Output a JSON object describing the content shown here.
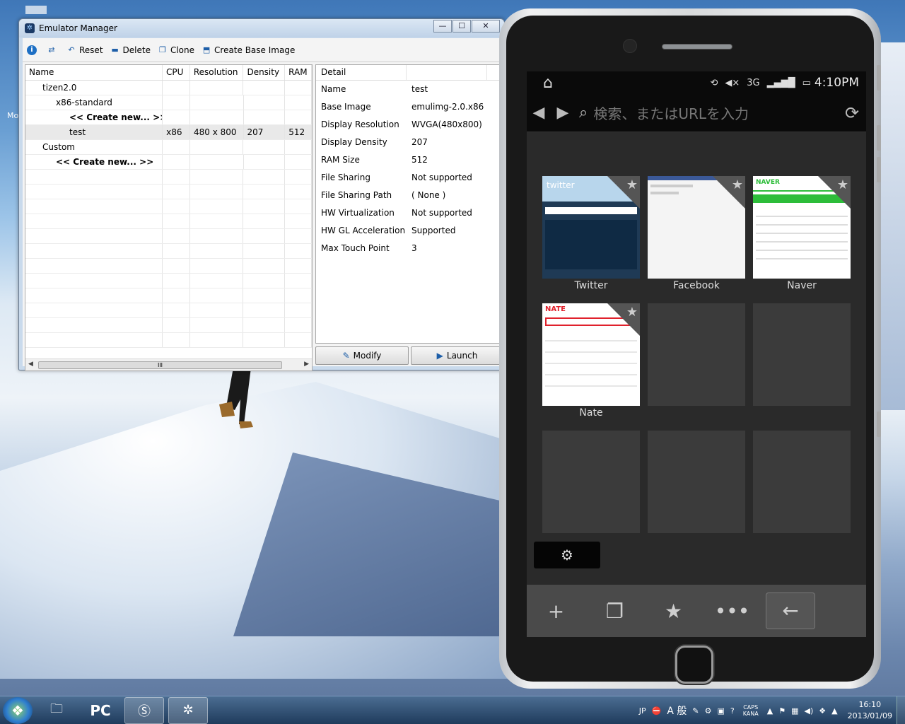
{
  "window": {
    "title": "Emulator Manager",
    "min": "—",
    "max": "☐",
    "close": "✕"
  },
  "toolbar": {
    "info_icon": "info-icon",
    "refresh_icon": "refresh-icon",
    "reset": "Reset",
    "delete": "Delete",
    "clone": "Clone",
    "create_base": "Create Base Image"
  },
  "tree": {
    "headers": [
      "Name",
      "CPU",
      "Resolution",
      "Density",
      "RAM"
    ],
    "rows": [
      {
        "name": "tizen2.0",
        "cpu": "",
        "res": "",
        "den": "",
        "ram": ""
      },
      {
        "name": "x86-standard",
        "cpu": "",
        "res": "",
        "den": "",
        "ram": ""
      },
      {
        "name": "<< Create new... >>",
        "cpu": "",
        "res": "",
        "den": "",
        "ram": ""
      },
      {
        "name": "test",
        "cpu": "x86",
        "res": "480 x 800",
        "den": "207",
        "ram": "512"
      },
      {
        "name": "Custom",
        "cpu": "",
        "res": "",
        "den": "",
        "ram": ""
      },
      {
        "name": "<< Create new... >>",
        "cpu": "",
        "res": "",
        "den": "",
        "ram": ""
      }
    ],
    "scroll_grip": "III"
  },
  "detail": {
    "header": "Detail",
    "rows": [
      {
        "k": "Name",
        "v": "test"
      },
      {
        "k": "Base Image",
        "v": "emulimg-2.0.x86"
      },
      {
        "k": "Display Resolution",
        "v": "WVGA(480x800)"
      },
      {
        "k": "Display Density",
        "v": "207"
      },
      {
        "k": "RAM Size",
        "v": "512"
      },
      {
        "k": "File Sharing",
        "v": "Not supported"
      },
      {
        "k": "File Sharing Path",
        "v": "( None )"
      },
      {
        "k": "HW Virtualization",
        "v": "Not supported"
      },
      {
        "k": "HW GL Acceleration",
        "v": "Supported"
      },
      {
        "k": "Max Touch Point",
        "v": "3"
      }
    ],
    "modify": "Modify",
    "launch": "Launch"
  },
  "phone": {
    "time": "4:10PM",
    "network": "3G",
    "url_placeholder": "検索、またはURLを入力",
    "tiles": [
      "Twitter",
      "Facebook",
      "Naver",
      "Nate"
    ]
  },
  "taskbar": {
    "pc_label": "PC",
    "lang": "JP",
    "ime": "A 般",
    "caps": "CAPS",
    "kana": "KANA",
    "time": "16:10",
    "date": "2013/01/09"
  },
  "desktop": {
    "label": "Mo"
  }
}
